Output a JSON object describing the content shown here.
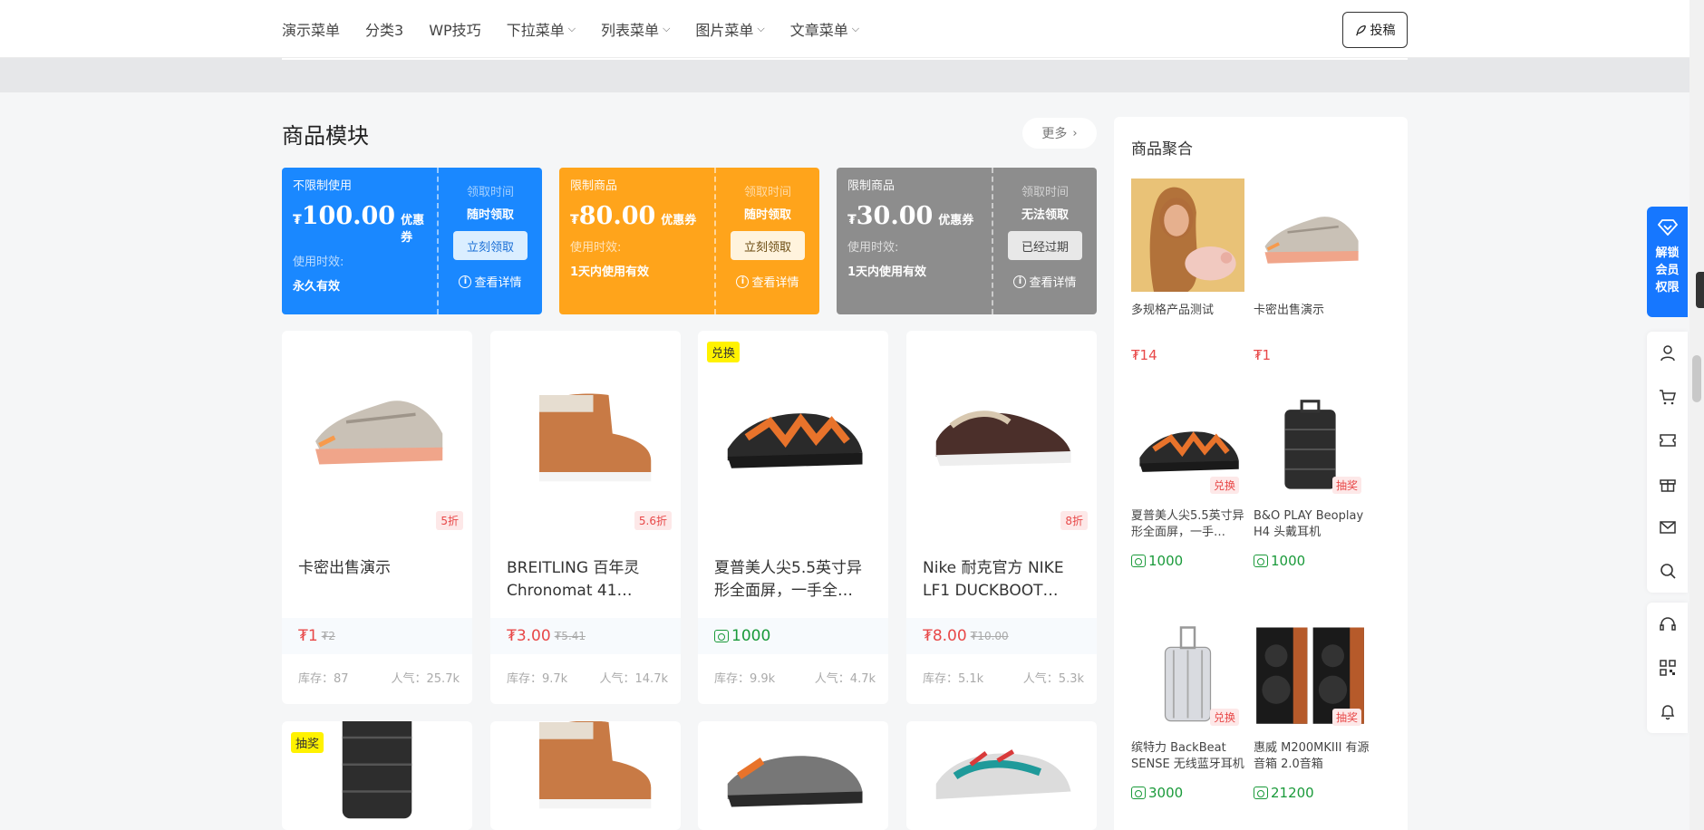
{
  "nav": {
    "items": [
      {
        "label": "演示菜单",
        "dropdown": false
      },
      {
        "label": "分类3",
        "dropdown": false
      },
      {
        "label": "WP技巧",
        "dropdown": false
      },
      {
        "label": "下拉菜单",
        "dropdown": true
      },
      {
        "label": "列表菜单",
        "dropdown": true
      },
      {
        "label": "图片菜单",
        "dropdown": true
      },
      {
        "label": "文章菜单",
        "dropdown": true
      }
    ],
    "post_label": "投稿"
  },
  "section": {
    "title": "商品模块",
    "more_label": "更多"
  },
  "coupons": [
    {
      "type": "不限制使用",
      "currency": "₮",
      "amount": "100.00",
      "unit": "优惠券",
      "validity_label": "使用时效:",
      "validity": "永久有效",
      "time_label": "领取时间",
      "time_value": "随时领取",
      "button": "立刻领取",
      "detail": "查看详情",
      "color": "#1a88ff",
      "button_bg": "#dbeeff",
      "button_color": "#1a6fd6"
    },
    {
      "type": "限制商品",
      "currency": "₮",
      "amount": "80.00",
      "unit": "优惠券",
      "validity_label": "使用时效:",
      "validity": "1天内使用有效",
      "time_label": "领取时间",
      "time_value": "随时领取",
      "button": "立刻领取",
      "detail": "查看详情",
      "color": "#ffa41b",
      "button_bg": "#fff3dd",
      "button_color": "#6a4a10"
    },
    {
      "type": "限制商品",
      "currency": "₮",
      "amount": "30.00",
      "unit": "优惠券",
      "validity_label": "使用时效:",
      "validity": "1天内使用有效",
      "time_label": "领取时间",
      "time_value": "无法领取",
      "button": "已经过期",
      "detail": "查看详情",
      "color": "#8d8d8d",
      "button_bg": "#e8e8e8",
      "button_color": "#444444"
    }
  ],
  "products": [
    {
      "title": "卡密出售演示",
      "discount": "5折",
      "tag": "",
      "price": "₮1",
      "old_price": "₮2",
      "points": "",
      "stock": "库存：87",
      "popularity": "人气：25.7k",
      "image": "sneaker-grey"
    },
    {
      "title": "BREITLING 百年灵 Chronomat 41…",
      "discount": "5.6折",
      "tag": "",
      "price": "₮3.00",
      "old_price": "₮5.41",
      "points": "",
      "stock": "库存：9.7k",
      "popularity": "人气：14.7k",
      "image": "boot-brown"
    },
    {
      "title": "夏普美人尖5.5英寸异形全面屏，一手全…",
      "discount": "",
      "tag": "兑换",
      "price": "",
      "old_price": "",
      "points": "1000",
      "stock": "库存：9.9k",
      "popularity": "人气：4.7k",
      "image": "sneaker-orange"
    },
    {
      "title": "Nike 耐克官方 NIKE LF1 DUCKBOOT…",
      "discount": "8折",
      "tag": "",
      "price": "₮8.00",
      "old_price": "₮10.00",
      "points": "",
      "stock": "库存：5.1k",
      "popularity": "人气：5.3k",
      "image": "slipper-dark"
    }
  ],
  "products_row2": [
    {
      "tag": "抽奖",
      "image": "suitcase"
    },
    {
      "tag": "",
      "image": "boot-brown"
    },
    {
      "tag": "",
      "image": "sneaker-grey-orange"
    },
    {
      "tag": "",
      "image": "sneaker-teal"
    }
  ],
  "panel": {
    "title": "商品聚合",
    "items": [
      {
        "name": "多规格产品测试",
        "price": "₮14",
        "points": "",
        "tag": "",
        "image": "woman-pig"
      },
      {
        "name": "卡密出售演示",
        "price": "₮1",
        "points": "",
        "tag": "",
        "image": "sneaker-grey"
      },
      {
        "name": "夏普美人尖5.5英寸异形全面屏，一手…",
        "price": "",
        "points": "1000",
        "tag": "兑换",
        "image": "sneaker-orange"
      },
      {
        "name": "B&O PLAY Beoplay H4 头戴耳机",
        "price": "",
        "points": "1000",
        "tag": "抽奖",
        "image": "suitcase"
      },
      {
        "name": "缤特力 BackBeat SENSE 无线蓝牙耳机",
        "price": "",
        "points": "3000",
        "tag": "兑换",
        "image": "suitcase-silver"
      },
      {
        "name": "惠威 M200MKIII 有源音箱 2.0音箱",
        "price": "",
        "points": "21200",
        "tag": "抽奖",
        "image": "speakers"
      }
    ]
  },
  "sidebar": {
    "vip_label": [
      "解锁",
      "会员",
      "权限"
    ],
    "tools": [
      "user-icon",
      "cart-icon",
      "ticket-icon",
      "gift-icon",
      "mail-icon",
      "search-icon"
    ],
    "tools2": [
      "headset-icon",
      "qrcode-icon",
      "bell-icon"
    ]
  }
}
